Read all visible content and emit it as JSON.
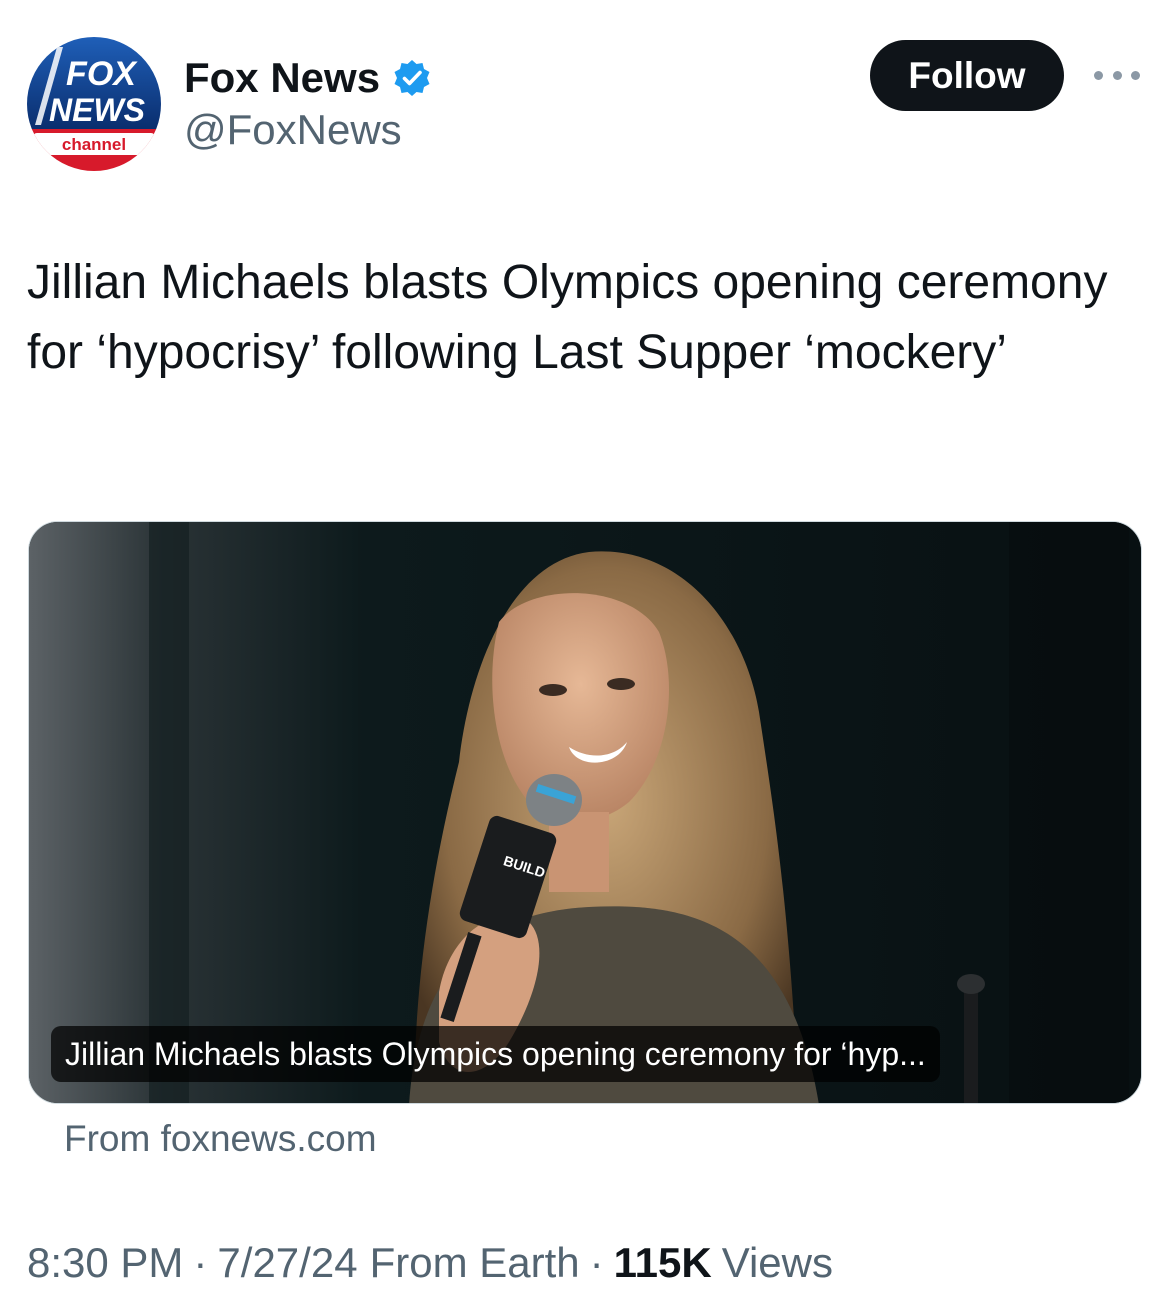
{
  "account": {
    "display_name": "Fox News",
    "handle": "@FoxNews",
    "verified": true,
    "avatar_logo_text": [
      "FOX",
      "NEWS",
      "channel"
    ]
  },
  "follow_label": "Follow",
  "tweet_text": "Jillian Michaels blasts Olympics opening ceremony for ‘hypocrisy’ following Last Supper ‘mockery’",
  "card": {
    "caption": "Jillian Michaels blasts Olympics opening ceremony for ‘hyp...",
    "image_alt_text": "BUILD"
  },
  "source": "From foxnews.com",
  "meta": {
    "time": "8:30 PM",
    "date": "7/27/24",
    "location": "From Earth",
    "views_count": "115K",
    "views_label": "Views"
  },
  "colors": {
    "text_primary": "#0f1419",
    "text_secondary": "#536471",
    "verified_blue": "#1d9bf0",
    "follow_button_bg": "#0f1419"
  },
  "icons": {
    "verified": "verified-badge-icon",
    "more": "more-options-icon"
  }
}
